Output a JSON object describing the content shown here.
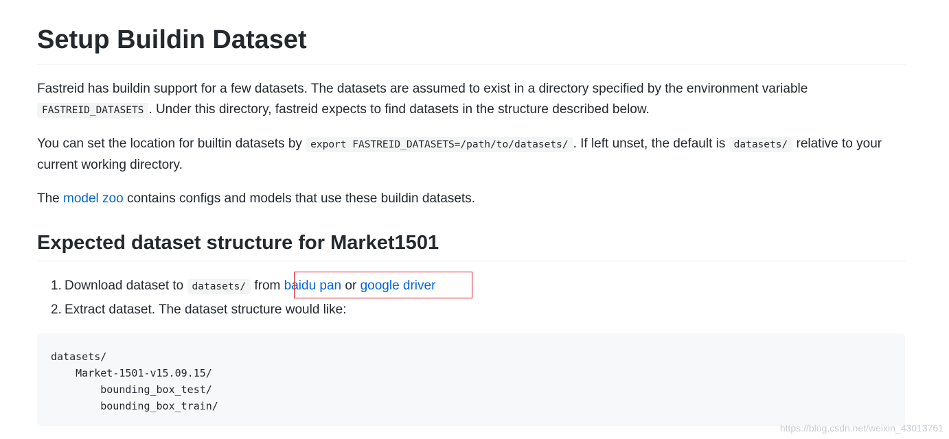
{
  "title": "Setup Buildin Dataset",
  "intro": {
    "text_before": "Fastreid has buildin support for a few datasets. The datasets are assumed to exist in a directory specified by the environment variable ",
    "code": "FASTREID_DATASETS",
    "text_after": ". Under this directory, fastreid expects to find datasets in the structure described below."
  },
  "location": {
    "text_before": "You can set the location for builtin datasets by ",
    "code_cmd": "export FASTREID_DATASETS=/path/to/datasets/",
    "text_mid": ". If left unset, the default is ",
    "code_default": "datasets/",
    "text_after": " relative to your current working directory."
  },
  "zoo": {
    "text_before": "The ",
    "link": "model zoo",
    "text_after": " contains configs and models that use these buildin datasets."
  },
  "section_title": "Expected dataset structure for Market1501",
  "steps": [
    {
      "num": "1.",
      "text_before": "Download dataset to ",
      "code": "datasets/",
      "text_mid": " from ",
      "link1": "baidu pan",
      "text_or": " or ",
      "link2": "google driver"
    },
    {
      "num": "2.",
      "text": "Extract dataset. The dataset structure would like:"
    }
  ],
  "code_block": "datasets/\n    Market-1501-v15.09.15/\n        bounding_box_test/\n        bounding_box_train/",
  "watermark": "https://blog.csdn.net/weixin_43013761",
  "colors": {
    "link": "#0366d6",
    "highlight_border": "#d9121f"
  }
}
